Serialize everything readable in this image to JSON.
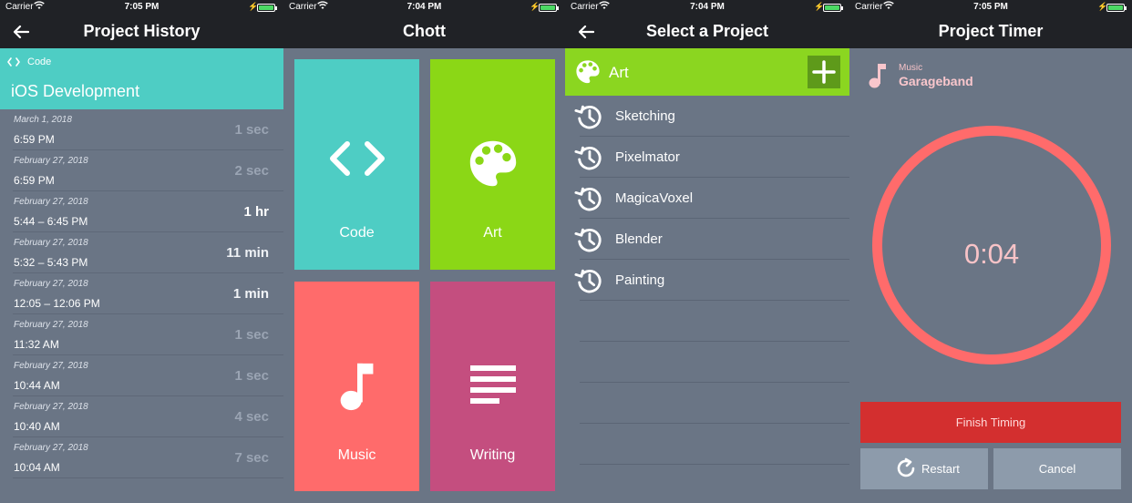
{
  "screens": {
    "history": {
      "status": {
        "carrier": "Carrier",
        "time": "7:05 PM"
      },
      "title": "Project History",
      "category": "Code",
      "project": "iOS Development",
      "entries": [
        {
          "date": "March 1, 2018",
          "range": "6:59 PM",
          "duration": "1 sec"
        },
        {
          "date": "February 27, 2018",
          "range": "6:59 PM",
          "duration": "2 sec"
        },
        {
          "date": "February 27, 2018",
          "range": "5:44 – 6:45 PM",
          "duration": "1 hr"
        },
        {
          "date": "February 27, 2018",
          "range": "5:32 – 5:43 PM",
          "duration": "11 min"
        },
        {
          "date": "February 27, 2018",
          "range": "12:05 – 12:06 PM",
          "duration": "1 min"
        },
        {
          "date": "February 27, 2018",
          "range": "11:32 AM",
          "duration": "1 sec"
        },
        {
          "date": "February 27, 2018",
          "range": "10:44 AM",
          "duration": "1 sec"
        },
        {
          "date": "February 27, 2018",
          "range": "10:40 AM",
          "duration": "4 sec"
        },
        {
          "date": "February 27, 2018",
          "range": "10:04 AM",
          "duration": "7 sec"
        }
      ]
    },
    "home": {
      "status": {
        "carrier": "Carrier",
        "time": "7:04 PM"
      },
      "title": "Chott",
      "tiles": [
        {
          "label": "Code",
          "icon": "code-icon",
          "color": "#4ecdc4"
        },
        {
          "label": "Art",
          "icon": "palette-icon",
          "color": "#8bd716"
        },
        {
          "label": "Music",
          "icon": "music-note-icon",
          "color": "#ff6b6b"
        },
        {
          "label": "Writing",
          "icon": "text-lines-icon",
          "color": "#c44e7f"
        }
      ]
    },
    "select": {
      "status": {
        "carrier": "Carrier",
        "time": "7:04 PM"
      },
      "title": "Select a Project",
      "category": "Art",
      "projects": [
        "Sketching",
        "Pixelmator",
        "MagicaVoxel",
        "Blender",
        "Painting"
      ]
    },
    "timer": {
      "status": {
        "carrier": "Carrier",
        "time": "7:05 PM"
      },
      "title": "Project Timer",
      "category": "Music",
      "project": "Garageband",
      "elapsed": "0:04",
      "finish_label": "Finish Timing",
      "restart_label": "Restart",
      "cancel_label": "Cancel"
    }
  }
}
